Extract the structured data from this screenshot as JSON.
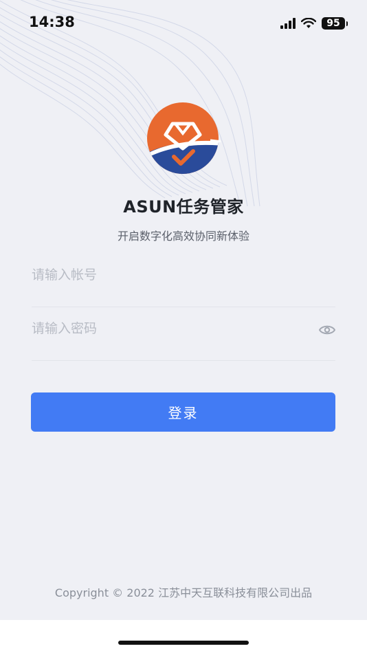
{
  "status_bar": {
    "time": "14:38",
    "battery": "95",
    "signal_icon": "cellular-signal-icon",
    "wifi_icon": "wifi-icon"
  },
  "app": {
    "title": "ASUN任务管家",
    "subtitle": "开启数字化高效协同新体验",
    "logo_icon": "asun-logo-icon"
  },
  "form": {
    "account_placeholder": "请输入帐号",
    "account_value": "",
    "password_placeholder": "请输入密码",
    "password_value": "",
    "password_toggle_icon": "eye-icon",
    "login_label": "登录"
  },
  "footer": {
    "copyright": "Copyright © 2022 江苏中天互联科技有限公司出品"
  },
  "colors": {
    "primary": "#427bf4",
    "background": "#eff0f5",
    "logo_orange": "#e8692f",
    "logo_blue": "#2a4b9a"
  }
}
